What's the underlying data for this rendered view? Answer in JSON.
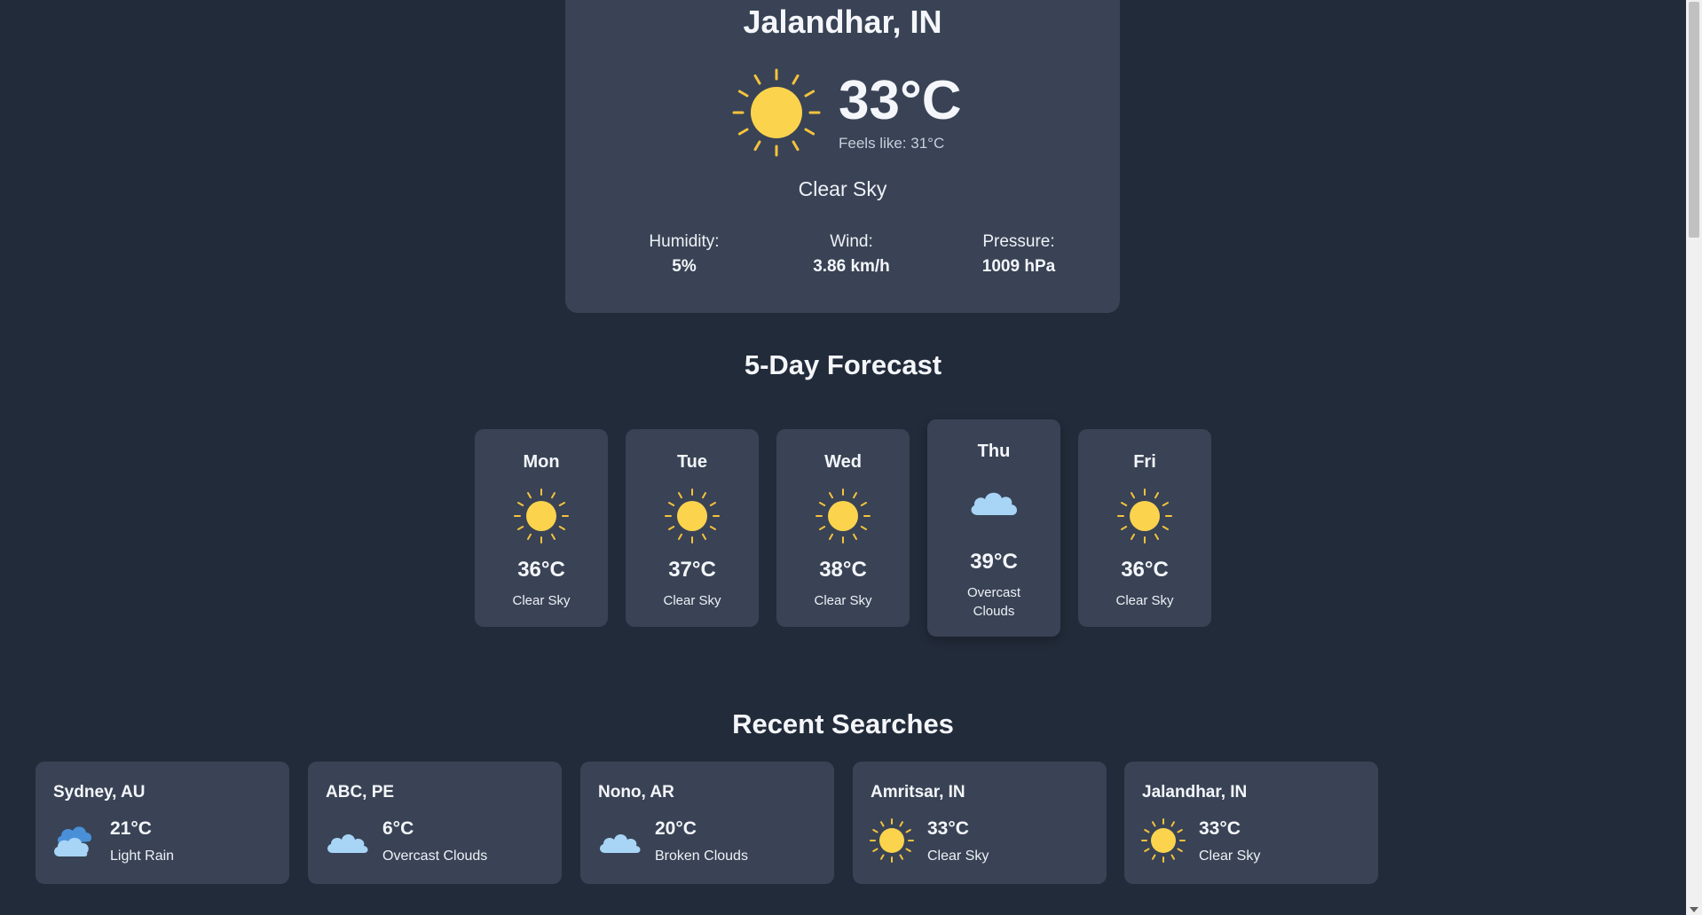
{
  "colors": {
    "background": "#222b3a",
    "card": "#394355",
    "sun": "#fcd34d",
    "sun_rays": "#f6c33c",
    "cloud": "#a8d4f5",
    "cloud_dark": "#4a90d9"
  },
  "current": {
    "city": "Jalandhar, IN",
    "icon": "sun-icon",
    "temperature": "33°C",
    "feels_like": "Feels like: 31°C",
    "condition": "Clear Sky",
    "humidity": {
      "label": "Humidity:",
      "value": "5%"
    },
    "wind": {
      "label": "Wind:",
      "value": "3.86 km/h"
    },
    "pressure": {
      "label": "Pressure:",
      "value": "1009 hPa"
    }
  },
  "forecast": {
    "title": "5-Day Forecast",
    "days": [
      {
        "day": "Mon",
        "icon": "sun-icon",
        "temp": "36°C",
        "desc": "Clear Sky"
      },
      {
        "day": "Tue",
        "icon": "sun-icon",
        "temp": "37°C",
        "desc": "Clear Sky"
      },
      {
        "day": "Wed",
        "icon": "sun-icon",
        "temp": "38°C",
        "desc": "Clear Sky"
      },
      {
        "day": "Thu",
        "icon": "cloud-icon",
        "temp": "39°C",
        "desc": "Overcast Clouds"
      },
      {
        "day": "Fri",
        "icon": "sun-icon",
        "temp": "36°C",
        "desc": "Clear Sky"
      }
    ]
  },
  "recent": {
    "title": "Recent Searches",
    "items": [
      {
        "city": "Sydney, AU",
        "icon": "rain-cloud-icon",
        "temp": "21°C",
        "desc": "Light Rain"
      },
      {
        "city": "ABC, PE",
        "icon": "cloud-icon",
        "temp": "6°C",
        "desc": "Overcast Clouds"
      },
      {
        "city": "Nono, AR",
        "icon": "cloud-icon",
        "temp": "20°C",
        "desc": "Broken Clouds"
      },
      {
        "city": "Amritsar, IN",
        "icon": "sun-icon",
        "temp": "33°C",
        "desc": "Clear Sky"
      },
      {
        "city": "Jalandhar, IN",
        "icon": "sun-icon",
        "temp": "33°C",
        "desc": "Clear Sky"
      }
    ]
  }
}
